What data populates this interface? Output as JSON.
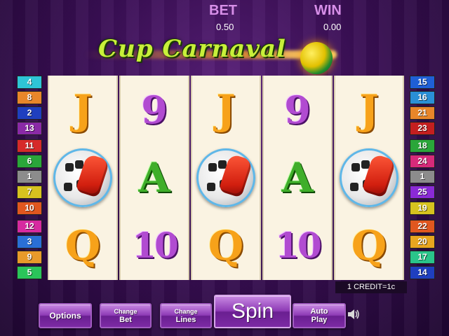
{
  "hud": {
    "bet_label": "BET",
    "bet_value": "0.50",
    "win_label": "WIN",
    "win_value": "0.00"
  },
  "logo": {
    "text": "Cup Carnaval",
    "icon": "soccer-ball-icon"
  },
  "reels": [
    [
      "J",
      "soccer-ball-glove",
      "Q"
    ],
    [
      "9",
      "A",
      "10"
    ],
    [
      "J",
      "soccer-ball-glove",
      "Q"
    ],
    [
      "9",
      "A",
      "10"
    ],
    [
      "J",
      "soccer-ball-glove",
      "Q"
    ]
  ],
  "paylines_left": [
    {
      "label": "4",
      "color": "#2ec4d6"
    },
    {
      "label": "8",
      "color": "#e8862a"
    },
    {
      "label": "2",
      "color": "#1f3fbf"
    },
    {
      "label": "13",
      "color": "#8a2aa6"
    },
    {
      "label": "11",
      "color": "#d62a2a"
    },
    {
      "label": "6",
      "color": "#2aa63a"
    },
    {
      "label": "1",
      "color": "#8c8c8c"
    },
    {
      "label": "7",
      "color": "#d6c21f"
    },
    {
      "label": "10",
      "color": "#e0571f"
    },
    {
      "label": "12",
      "color": "#d62aa0"
    },
    {
      "label": "3",
      "color": "#2a6fd6"
    },
    {
      "label": "9",
      "color": "#e89a2a"
    },
    {
      "label": "5",
      "color": "#2ac45a"
    }
  ],
  "paylines_right": [
    {
      "label": "15",
      "color": "#1f5fd6"
    },
    {
      "label": "16",
      "color": "#2a8fd6"
    },
    {
      "label": "21",
      "color": "#e8862a"
    },
    {
      "label": "23",
      "color": "#c41f1f"
    },
    {
      "label": "18",
      "color": "#2aa63a"
    },
    {
      "label": "24",
      "color": "#d62a7a"
    },
    {
      "label": "1",
      "color": "#8c8c8c"
    },
    {
      "label": "25",
      "color": "#8a2ad6"
    },
    {
      "label": "19",
      "color": "#d6c21f"
    },
    {
      "label": "22",
      "color": "#e0571f"
    },
    {
      "label": "20",
      "color": "#e8a61f"
    },
    {
      "label": "17",
      "color": "#2ac48a"
    },
    {
      "label": "14",
      "color": "#1f3fbf"
    }
  ],
  "credit_info": "1 CREDIT=1c",
  "buttons": {
    "options": "Options",
    "change_bet_top": "Change",
    "change_bet_bottom": "Bet",
    "change_lines_top": "Change",
    "change_lines_bottom": "Lines",
    "spin": "Spin",
    "autoplay_top": "Auto",
    "autoplay_bottom": "Play"
  },
  "sound_icon": "speaker-icon"
}
